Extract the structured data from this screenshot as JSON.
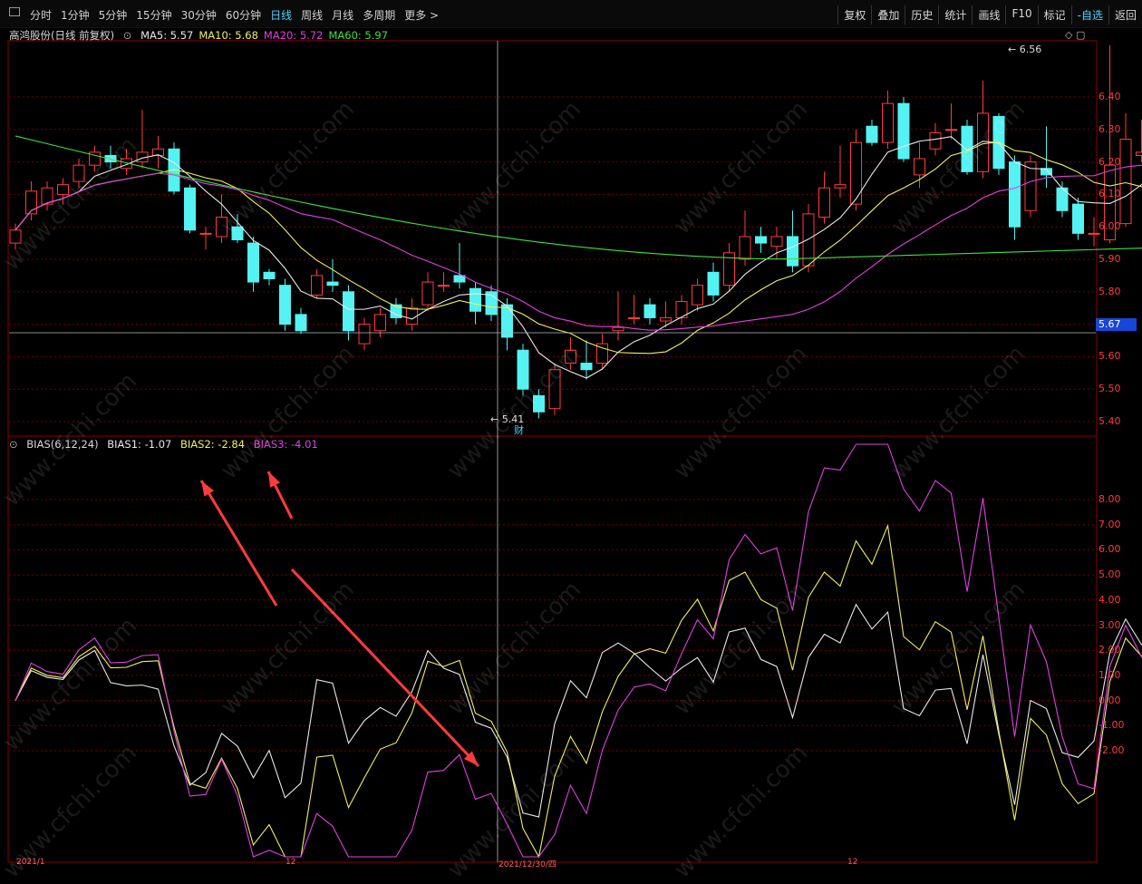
{
  "toolbar": {
    "tabs": [
      "分时",
      "1分钟",
      "5分钟",
      "15分钟",
      "30分钟",
      "60分钟",
      "日线",
      "周线",
      "月线",
      "多周期",
      "更多 >"
    ],
    "active_tab": "日线",
    "right_buttons": [
      "复权",
      "叠加",
      "历史",
      "统计",
      "画线",
      "F10",
      "标记",
      "-自选",
      "返回"
    ]
  },
  "main_chart": {
    "stock_title": "高鸿股份(日线 前复权)",
    "ma_labels": [
      {
        "text": "MA5: 5.57",
        "color": "#e8e8e8"
      },
      {
        "text": "MA10: 5.68",
        "color": "#f0f060"
      },
      {
        "text": "MA20: 5.72",
        "color": "#e040e0"
      },
      {
        "text": "MA60: 5.97",
        "color": "#40e040"
      }
    ],
    "y_axis": [
      "6.40",
      "6.30",
      "6.20",
      "6.10",
      "6.00",
      "5.90",
      "5.80",
      "5.70",
      "5.60",
      "5.50",
      "5.40"
    ],
    "current_price": "5.67",
    "high_marker": "6.56",
    "low_marker": "5.41",
    "cai_marker": "财"
  },
  "bias_chart": {
    "title": "BIAS(6,12,24)",
    "bias1": "BIAS1: -1.07",
    "bias2": "BIAS2: -2.84",
    "bias3": "BIAS3: -4.01",
    "y_axis": [
      "8.00",
      "7.00",
      "6.00",
      "5.00",
      "4.00",
      "3.00",
      "2.00",
      "1.00",
      "0.00",
      "-1.00",
      "-2.00"
    ]
  },
  "date_strip": {
    "labels": [
      "2021/1",
      "12",
      "2021/12/30/四",
      "12"
    ]
  },
  "watermark": "www.cfchi.com",
  "colors": {
    "up_candle": "#ff3b3b",
    "down_candle": "#54f2f2",
    "ma5": "#e8e8e8",
    "ma10": "#f0f060",
    "ma20": "#e040e0",
    "ma60": "#40e040",
    "grid": "#7a0000",
    "arrow": "#ff3b3b"
  }
}
